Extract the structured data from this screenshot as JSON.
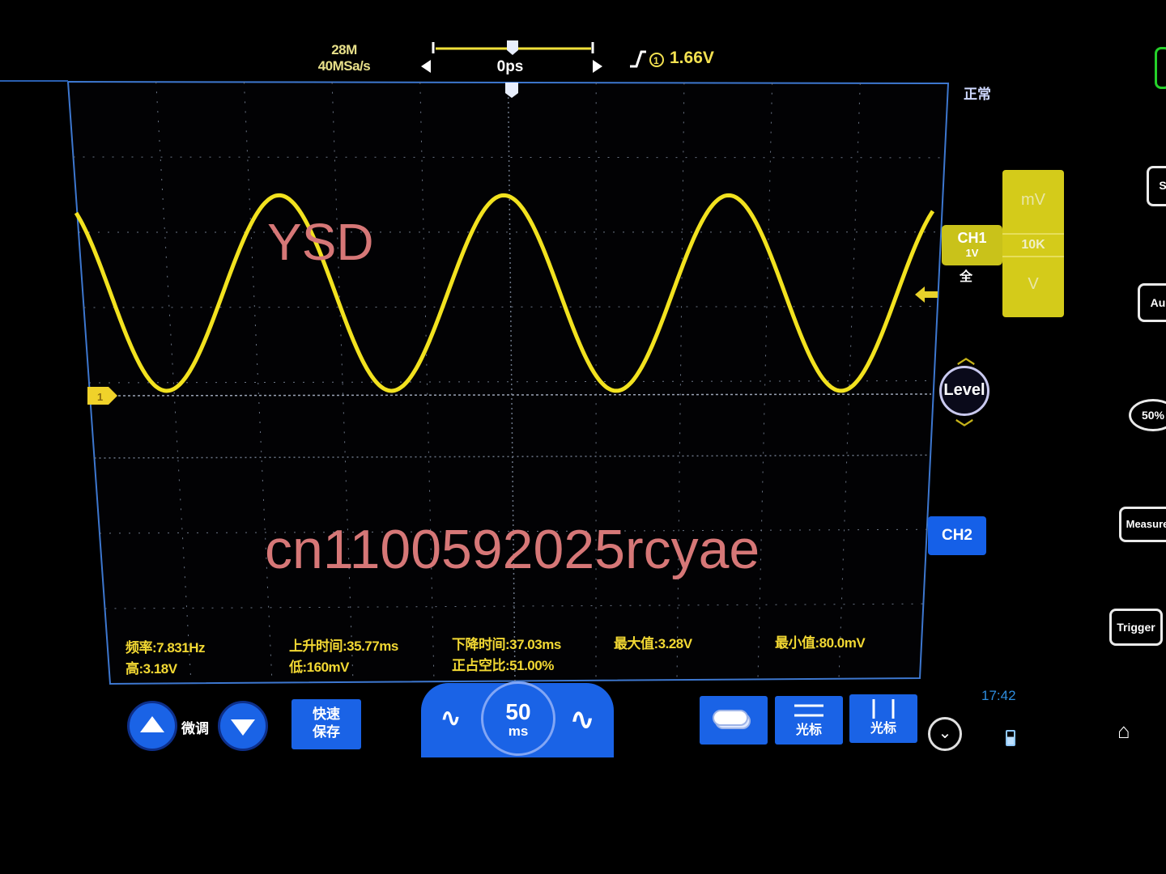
{
  "header": {
    "memory_depth": "28M",
    "sample_rate": "40MSa/s",
    "time_offset": "0ps",
    "trigger_icon_label": "1",
    "trigger_level": "1.66V",
    "acquire_mode": "正常"
  },
  "channel1": {
    "name": "CH1",
    "scale": "1V",
    "bandwidth": "全",
    "marker_label": "1",
    "color": "#f2e21f"
  },
  "unit_selector": {
    "items": [
      "mV",
      "10K",
      "V"
    ]
  },
  "level_button": {
    "label": "Level"
  },
  "ch2_button": {
    "label": "CH2"
  },
  "measurements": {
    "frequency": "频率:7.831Hz",
    "high": "高:3.18V",
    "rise_time": "上升时间:35.77ms",
    "low": "低:160mV",
    "fall_time": "下降时间:37.03ms",
    "duty_cycle": "正占空比:51.00%",
    "max": "最大值:3.28V",
    "min": "最小值:80.0mV"
  },
  "bottom_bar": {
    "fine_label": "微调",
    "quick_save": [
      "快速",
      "保存"
    ],
    "timebase_value": "50",
    "timebase_unit": "ms",
    "cursor1_label": "光标",
    "cursor2_label": "光标"
  },
  "status": {
    "clock": "17:42"
  },
  "side_buttons": [
    "S",
    "Au",
    "50%",
    "Measure",
    "Trigger"
  ],
  "watermarks": {
    "top": "YSD",
    "center": "cn1100592025rcyae"
  },
  "waveform": {
    "type": "sine",
    "frequency_hz": 7.831,
    "max_v": 3.28,
    "min_v": 0.08,
    "volts_per_div": 1,
    "time_per_div_ms": 50
  }
}
